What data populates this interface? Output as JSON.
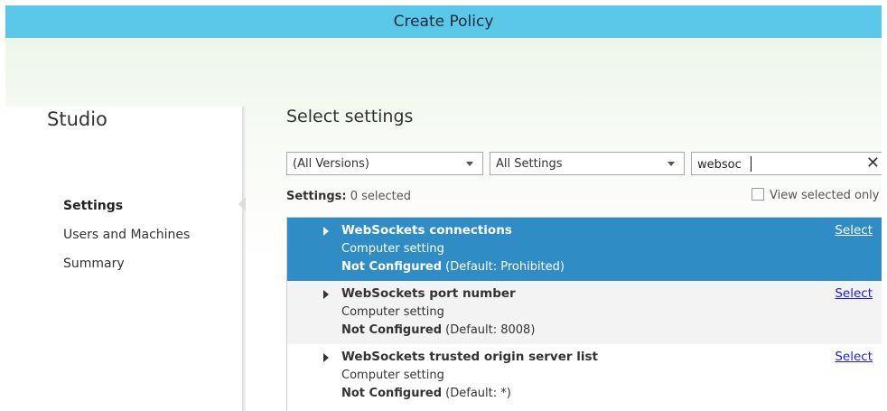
{
  "window": {
    "title": "Create Policy"
  },
  "sidebar": {
    "brand": "Studio",
    "items": [
      {
        "label": "Settings",
        "active": true
      },
      {
        "label": "Users and Machines",
        "active": false
      },
      {
        "label": "Summary",
        "active": false
      }
    ]
  },
  "main": {
    "title": "Select settings",
    "filters": {
      "version": "(All Versions)",
      "category": "All Settings",
      "search_value": "websoc"
    },
    "settings_label": "Settings:",
    "settings_count": "0 selected",
    "view_selected_label": "View selected only",
    "rows": [
      {
        "name": "WebSockets connections",
        "kind": "Computer setting",
        "state": "Not Configured",
        "default": "(Default: Prohibited)",
        "action": "Select",
        "selected": true
      },
      {
        "name": "WebSockets port number",
        "kind": "Computer setting",
        "state": "Not Configured",
        "default": "(Default: 8008)",
        "action": "Select",
        "selected": false
      },
      {
        "name": "WebSockets trusted origin server list",
        "kind": "Computer setting",
        "state": "Not Configured",
        "default": "(Default: *)",
        "action": "Select",
        "selected": false
      }
    ]
  },
  "colors": {
    "titlebar": "#5bc8ea",
    "selected_row": "#2f8cc4",
    "link": "#1a1aee"
  },
  "icons": {
    "clear": "close-icon",
    "dropdown": "chevron-down-icon",
    "expand": "expand-arrow-icon"
  }
}
